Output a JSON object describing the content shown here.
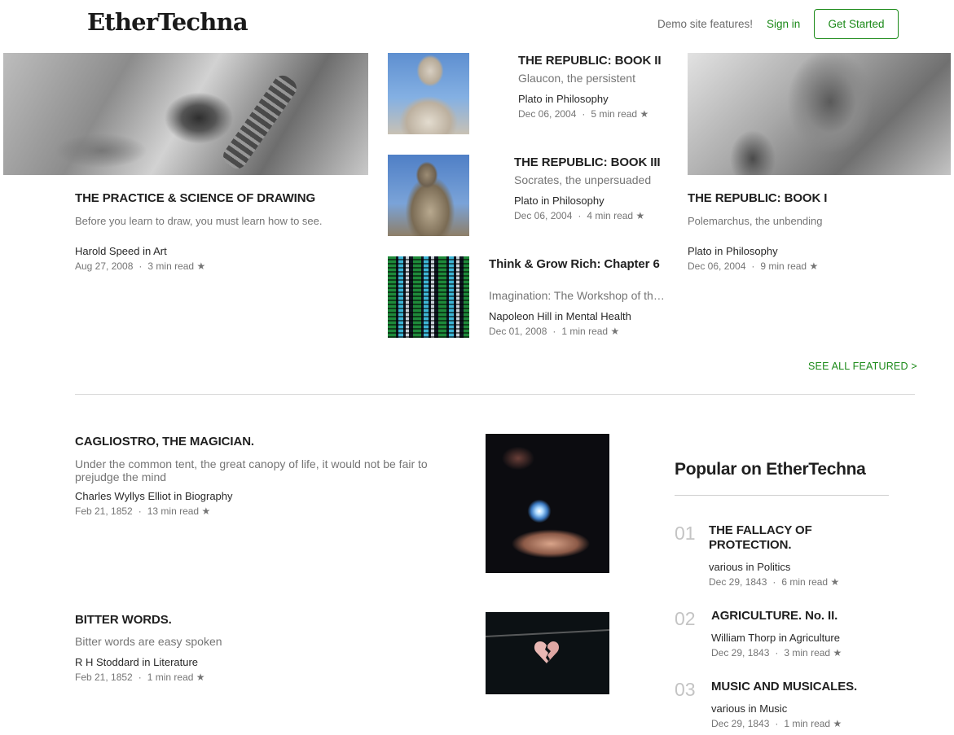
{
  "header": {
    "logo": "EtherTechna",
    "demo_link": "Demo site features!",
    "sign_in": "Sign in",
    "get_started": "Get Started"
  },
  "featured": [
    {
      "title": "THE PRACTICE & SCIENCE OF DRAWING",
      "subtitle": "Before you learn to draw, you must learn how to see.",
      "author": "Harold Speed in Art",
      "date": "Aug 27, 2008",
      "read": "3 min read"
    },
    {
      "title": "THE REPUBLIC: BOOK II",
      "subtitle": "Glaucon, the persistent",
      "author": "Plato in Philosophy",
      "date": "Dec 06, 2004",
      "read": "5 min read"
    },
    {
      "title": "THE REPUBLIC: BOOK III",
      "subtitle": "Socrates, the unpersuaded",
      "author": "Plato in Philosophy",
      "date": "Dec 06, 2004",
      "read": "4 min read"
    },
    {
      "title": "Think & Grow Rich: Chapter 6",
      "subtitle": "Imagination: The Workshop of the Mind",
      "author": "Napoleon Hill in Mental Health",
      "date": "Dec 01, 2008",
      "read": "1 min read"
    },
    {
      "title": "THE REPUBLIC: BOOK I",
      "subtitle": "Polemarchus, the unbending",
      "author": "Plato in Philosophy",
      "date": "Dec 06, 2004",
      "read": "9 min read"
    }
  ],
  "see_all": "SEE ALL FEATURED >",
  "stories": [
    {
      "title": "CAGLIOSTRO, THE MAGICIAN.",
      "subtitle": "Under the common tent, the great canopy of life, it would not be fair to prejudge the mind",
      "author": "Charles Wyllys Elliot in Biography",
      "date": "Feb 21, 1852",
      "read": "13 min read"
    },
    {
      "title": "BITTER WORDS.",
      "subtitle": "Bitter words are easy spoken",
      "author": "R H Stoddard in Literature",
      "date": "Feb 21, 1852",
      "read": "1 min read"
    }
  ],
  "popular": {
    "heading": "Popular on EtherTechna",
    "items": [
      {
        "num": "01",
        "title": "THE FALLACY OF PROTECTION.",
        "author": "various in Politics",
        "date": "Dec 29, 1843",
        "read": "6 min read"
      },
      {
        "num": "02",
        "title": "AGRICULTURE. No. II.",
        "author": "William Thorp in Agriculture",
        "date": "Dec 29, 1843",
        "read": "3 min read"
      },
      {
        "num": "03",
        "title": "MUSIC AND MUSICALES.",
        "author": "various in Music",
        "date": "Dec 29, 1843",
        "read": "1 min read"
      }
    ]
  },
  "icons": {
    "star": "star-icon"
  }
}
